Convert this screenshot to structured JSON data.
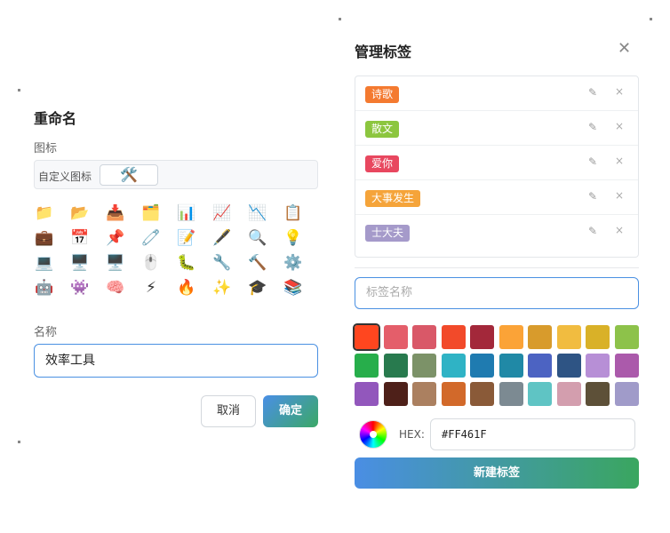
{
  "rename_dialog": {
    "title": "重命名",
    "icon_label": "图标",
    "custom_icon_label": "自定义图标",
    "current_icon": "🛠️",
    "icons": [
      "📁",
      "📂",
      "📥",
      "🗂️",
      "📊",
      "📈",
      "📉",
      "📋",
      "💼",
      "📅",
      "📌",
      "🧷",
      "📝",
      "🖋️",
      "🔍",
      "💡",
      "💻",
      "🖥️",
      "🖥️",
      "🖱️",
      "🐛",
      "🔧",
      "🔨",
      "⚙️",
      "🤖",
      "👾",
      "🧠",
      "⚡",
      "🔥",
      "✨",
      "🎓",
      "📚"
    ],
    "name_label": "名称",
    "name_value": "效率工具",
    "cancel_label": "取消",
    "confirm_label": "确定"
  },
  "tag_manager": {
    "title": "管理标签",
    "close_glyph": "✕",
    "tags": [
      {
        "name": "诗歌",
        "color": "#F47A30"
      },
      {
        "name": "散文",
        "color": "#8CC63F"
      },
      {
        "name": "爱你",
        "color": "#E8475F"
      },
      {
        "name": "大事发生",
        "color": "#F5A43A"
      },
      {
        "name": "士大夫",
        "color": "#A59ACA"
      }
    ],
    "edit_glyph": "✎",
    "delete_glyph": "×",
    "input_placeholder": "标签名称",
    "colors": [
      "#FF461F",
      "#E45E6A",
      "#D95868",
      "#F24A2A",
      "#A3283A",
      "#FBA337",
      "#D89B2C",
      "#F1BC40",
      "#D9B128",
      "#8DC24A",
      "#27AE4B",
      "#287A4E",
      "#7C9268",
      "#2FB3C5",
      "#1F7BB0",
      "#2089A6",
      "#4C63C2",
      "#2E5484",
      "#B78FD6",
      "#AB5AAB",
      "#9257BC",
      "#4E2019",
      "#AB8060",
      "#D2692A",
      "#8A5A38",
      "#7C8A92",
      "#5FC4C4",
      "#D39EAE",
      "#5D5038",
      "#A09BC9"
    ],
    "selected_color_index": 0,
    "hex_label": "HEX:",
    "hex_value": "#FF461F",
    "create_label": "新建标签"
  }
}
